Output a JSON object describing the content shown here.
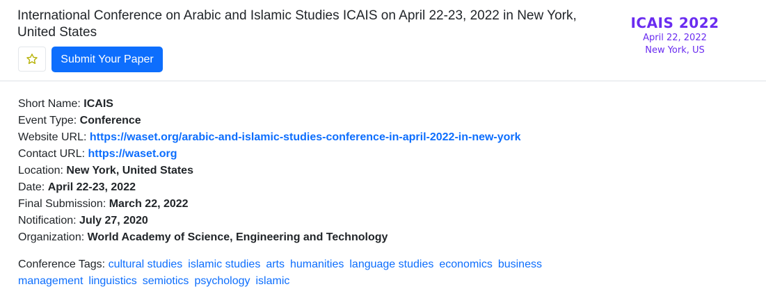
{
  "header": {
    "title": "International Conference on Arabic and Islamic Studies ICAIS on April 22-23, 2022 in New York, United States",
    "submit_label": "Submit Your Paper",
    "star_icon": "star-outline-icon"
  },
  "logo": {
    "line1": "ICAIS 2022",
    "line2": "April 22, 2022",
    "line3": "New York, US",
    "color": "#6a2cf0"
  },
  "details": {
    "short_name": {
      "label": "Short Name: ",
      "value": "ICAIS"
    },
    "event_type": {
      "label": "Event Type: ",
      "value": "Conference"
    },
    "website_url": {
      "label": "Website URL: ",
      "value": "https://waset.org/arabic-and-islamic-studies-conference-in-april-2022-in-new-york"
    },
    "contact_url": {
      "label": "Contact URL: ",
      "value": "https://waset.org"
    },
    "location": {
      "label": "Location: ",
      "value": "New York, United States"
    },
    "date": {
      "label": "Date: ",
      "value": "April 22-23, 2022"
    },
    "final_submission": {
      "label": "Final Submission: ",
      "value": "March 22, 2022"
    },
    "notification": {
      "label": "Notification: ",
      "value": "July 27, 2020"
    },
    "organization": {
      "label": "Organization: ",
      "value": "World Academy of Science, Engineering and Technology"
    }
  },
  "tags": {
    "label": "Conference Tags: ",
    "items": [
      "cultural studies",
      "islamic studies",
      "arts",
      "humanities",
      "language studies",
      "economics",
      "business management",
      "linguistics",
      "semiotics",
      "psychology",
      "islamic"
    ]
  },
  "colors": {
    "accent": "#0d6efd",
    "star": "#b5b000"
  }
}
